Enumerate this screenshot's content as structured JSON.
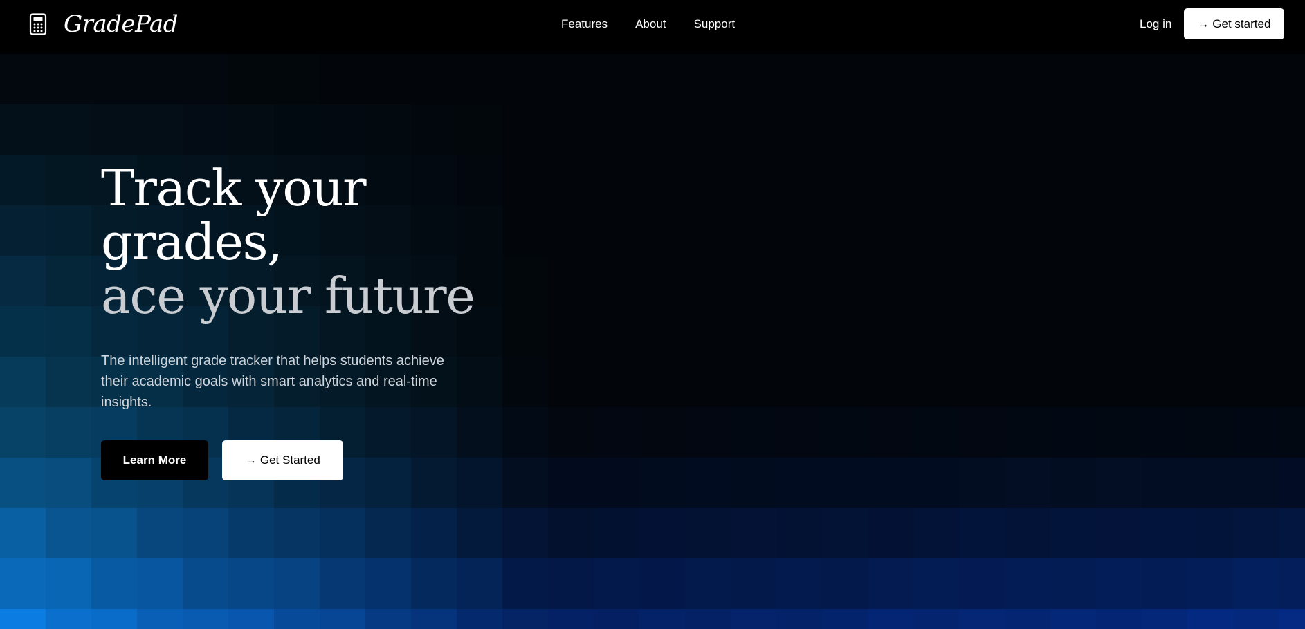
{
  "header": {
    "brand_icon": "calculator-icon",
    "brand_name": "GradePad",
    "nav_links": [
      "Features",
      "About",
      "Support"
    ],
    "login_label": "Log in",
    "cta_label": "→ Get started"
  },
  "hero": {
    "headline_line1": "Track your",
    "headline_line2": "grades,",
    "headline_line3": "ace your future",
    "subtext": "The intelligent grade tracker that helps students achieve their academic goals with smart analytics and real-time insights.",
    "primary_button_label": "Learn More",
    "secondary_button_label": "→ Get Started"
  },
  "colors": {
    "background": "#000000",
    "accent_blue": "#0a6aa0",
    "headline_accent": "#c9ccd1",
    "button_light": "#ffffff"
  }
}
